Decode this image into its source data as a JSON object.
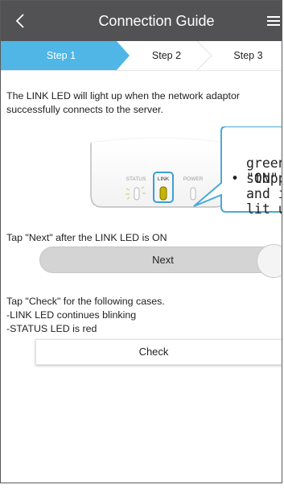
{
  "header": {
    "title": "Connection Guide"
  },
  "steps": [
    {
      "label": "Step 1",
      "active": true
    },
    {
      "label": "Step 2",
      "active": false
    },
    {
      "label": "Step 3",
      "active": false
    }
  ],
  "intro_text": "The LINK LED will light up when the network adaptor successfully connects to the server.",
  "device": {
    "status_label": "STATUS",
    "link_label": "LINK",
    "power_label": "POWER"
  },
  "callout": {
    "bullet": "•",
    "lines": [
      "\"ON\" m",
      "green",
      "stoppe",
      "and is",
      "lit up."
    ]
  },
  "next_instruction": "Tap \"Next\" after the LINK LED is ON",
  "next_button": "Next",
  "check_instruction": {
    "line1": "Tap \"Check\" for the following cases.",
    "line2": "-LINK LED continues blinking",
    "line3": "-STATUS LED is red"
  },
  "check_button": "Check",
  "colors": {
    "titlebar": "#525255",
    "step_active": "#4fb6e6",
    "callout_border": "#4aa9d9",
    "led_link": "#c8b400"
  }
}
